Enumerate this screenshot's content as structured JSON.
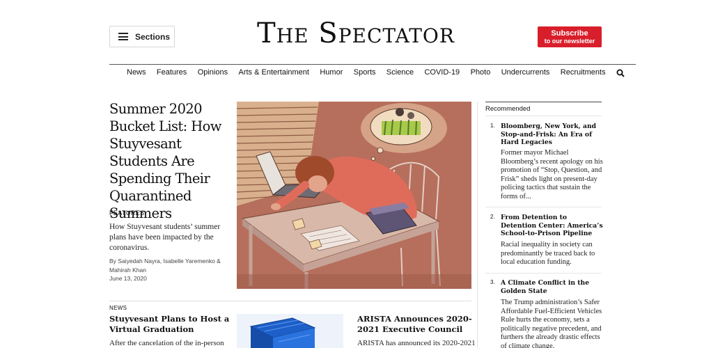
{
  "header": {
    "sections_label": "Sections",
    "masthead": "The Spectator",
    "subscribe_line1": "Subscribe",
    "subscribe_line2": "to our newsletter",
    "accent_color": "#d91e2b"
  },
  "nav": {
    "items": [
      "News",
      "Features",
      "Opinions",
      "Arts & Entertainment",
      "Humor",
      "Sports",
      "Science",
      "COVID-19",
      "Photo",
      "Undercurrents",
      "Recruitments"
    ],
    "search_icon": "search-icon"
  },
  "lead": {
    "title": "Summer 2020 Bucket List: How Stuyvesant Students Are Spending Their Quarantined Summers",
    "kicker": "FEATURES",
    "summary": "How Stuyvesant students’ summer plans have been impacted by the coronavirus.",
    "byline": "By Saiyedah Nayra, Isabelle Yaremenko & Mahirah Khan",
    "date": "June 13, 2020"
  },
  "stories": [
    {
      "kicker": "NEWS",
      "title": "Stuyvesant Plans to Host a Virtual Graduation",
      "summary": "After the cancelation of the in-person"
    },
    {
      "title": "ARISTA Announces 2020-2021 Executive Council",
      "summary": "ARISTA has announced its 2020-2021"
    }
  ],
  "recommended": {
    "heading": "Recommended",
    "items": [
      {
        "num": "1.",
        "title": "Bloomberg, New York, and Stop-and-Frisk: An Era of Hard Legacies",
        "summary": "Former mayor Michael Bloomberg’s recent apology on his promotion of “Stop, Question, and Frisk” sheds light on present-day policing tactics that sustain the forms of..."
      },
      {
        "num": "2.",
        "title": "From Detention to Detention Center: America’s School-to-Prison Pipeline",
        "summary": "Racial inequality in society can predominantly be traced back to local education funding."
      },
      {
        "num": "3.",
        "title": "A Climate Conflict in the Golden State",
        "summary": "The Trump administration’s Safer Affordable Fuel-Efficient Vehicles Rule hurts the economy, sets a politically negative precedent, and furthers the already drastic effects of climate change."
      }
    ]
  }
}
